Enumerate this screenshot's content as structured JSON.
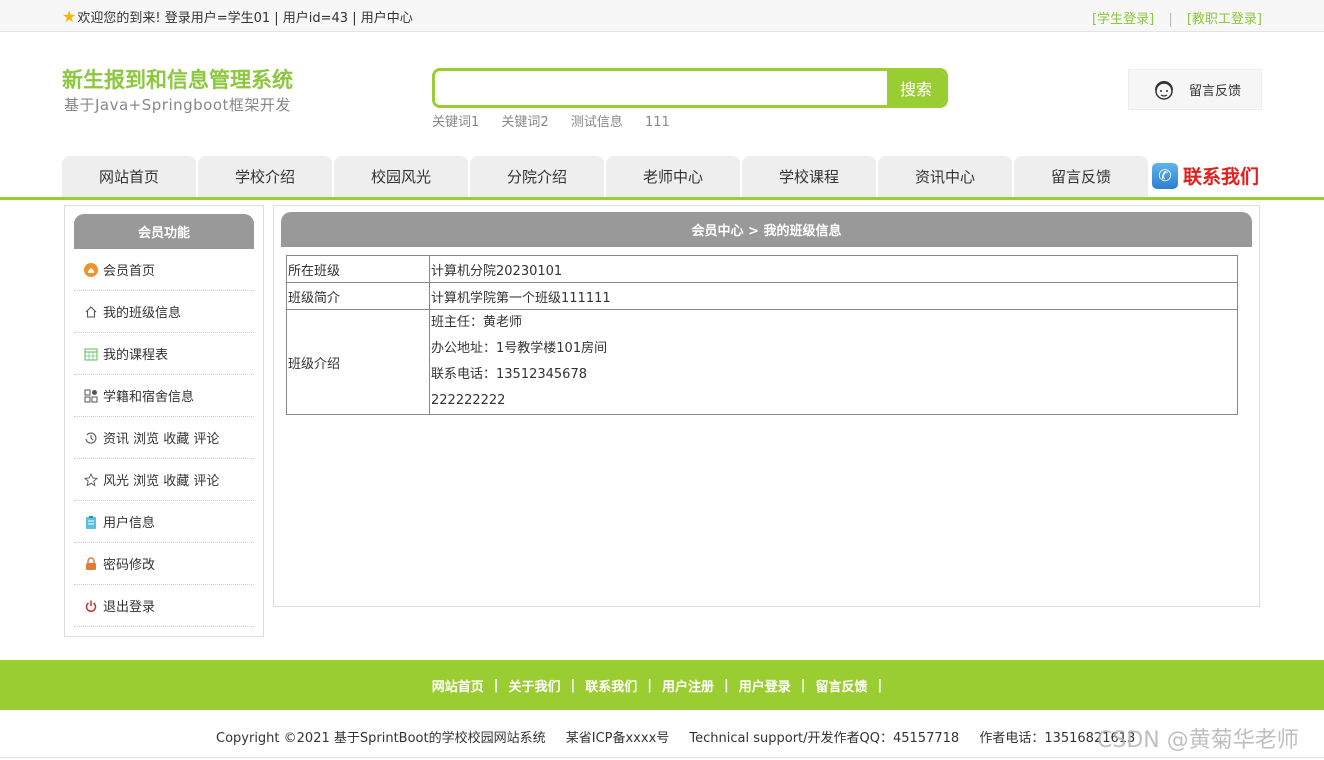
{
  "topbar": {
    "welcome": "欢迎您的到来!  登录用户=学生01 | 用户id=43 | 用户中心",
    "student_login": "[学生登录]",
    "staff_login": "[教职工登录]",
    "separator": "|"
  },
  "header": {
    "title": "新生报到和信息管理系统",
    "subtitle": "基于Java+Springboot框架开发",
    "search_placeholder": "",
    "search_button": "搜索",
    "keywords": [
      "关键词1",
      "关键词2",
      "测试信息",
      "111"
    ],
    "feedback": "留言反馈"
  },
  "nav": {
    "items": [
      "网站首页",
      "学校介绍",
      "校园风光",
      "分院介绍",
      "老师中心",
      "学校课程",
      "资讯中心",
      "留言反馈"
    ],
    "contact": "联系我们"
  },
  "sidebar": {
    "title": "会员功能",
    "items": [
      {
        "label": "会员首页",
        "icon": "home-orange-icon"
      },
      {
        "label": "我的班级信息",
        "icon": "house-icon"
      },
      {
        "label": "我的课程表",
        "icon": "calendar-icon"
      },
      {
        "label": "学籍和宿舍信息",
        "icon": "grid-icon"
      },
      {
        "label": "资讯 浏览 收藏 评论",
        "icon": "history-icon"
      },
      {
        "label": "风光 浏览 收藏 评论",
        "icon": "star-icon"
      },
      {
        "label": "用户信息",
        "icon": "clipboard-icon"
      },
      {
        "label": "密码修改",
        "icon": "lock-icon"
      },
      {
        "label": "退出登录",
        "icon": "power-icon"
      }
    ]
  },
  "main": {
    "breadcrumb": "会员中心 > 我的班级信息",
    "rows": {
      "class_label": "所在班级",
      "class_value": "计算机分院20230101",
      "brief_label": "班级简介",
      "brief_value": "计算机学院第一个班级111111",
      "intro_label": "班级介绍",
      "intro_lines": [
        "班主任：黄老师",
        "办公地址：1号教学楼101房间",
        "联系电话：13512345678",
        "222222222"
      ]
    }
  },
  "footer": {
    "links": [
      "网站首页",
      "关于我们",
      "联系我们",
      "用户注册",
      "用户登录",
      "留言反馈"
    ],
    "separator": "|",
    "copyright": "Copyright ©2021 基于SprintBoot的学校校园网站系统",
    "icp": "某省ICP备xxxx号",
    "support": "Technical support/开发作者QQ：45157718",
    "phone": "作者电话：13516821613",
    "watermark": "CSDN @黄菊华老师"
  },
  "colors": {
    "accent": "#9acd32",
    "header_gray": "#999999",
    "contact_red": "#e0201b"
  }
}
